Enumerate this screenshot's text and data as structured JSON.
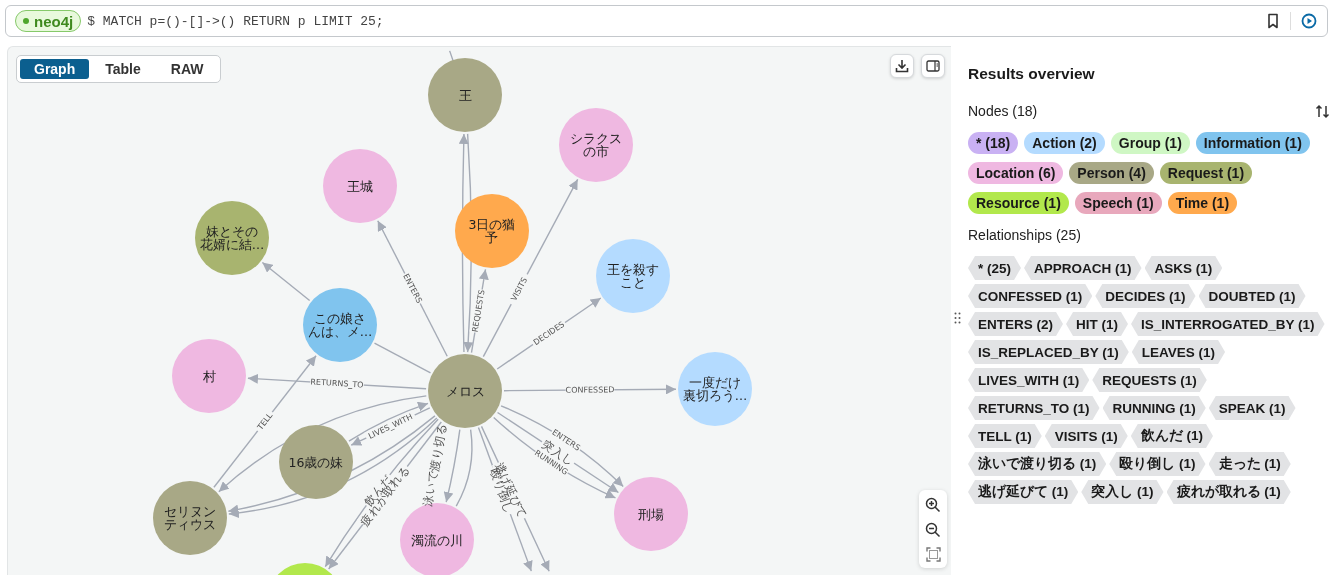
{
  "query_bar": {
    "database": "neo4j",
    "query": "$ MATCH p=()-[]->() RETURN p LIMIT 25;"
  },
  "view_tabs": [
    {
      "label": "Graph",
      "selected": true
    },
    {
      "label": "Table",
      "selected": false
    },
    {
      "label": "RAW",
      "selected": false
    }
  ],
  "graph": {
    "nodes": [
      {
        "lines": [
          "王"
        ],
        "color": "#a8a886"
      },
      {
        "lines": [
          "シラクス",
          "の市"
        ],
        "color": "#efb8e1"
      },
      {
        "lines": [
          "王城"
        ],
        "color": "#efb8e1"
      },
      {
        "lines": [
          "3日の猶",
          "予"
        ],
        "color": "#ffa94d"
      },
      {
        "lines": [
          "妹とその",
          "花婿に結…"
        ],
        "color": "#a8b46f"
      },
      {
        "lines": [
          "王を殺す",
          "こと"
        ],
        "color": "#b4dbff"
      },
      {
        "lines": [
          "この娘さ",
          "んは、メ…"
        ],
        "color": "#80c4ee"
      },
      {
        "lines": [
          "村"
        ],
        "color": "#efb8e1"
      },
      {
        "lines": [
          "メロス"
        ],
        "color": "#a8a886"
      },
      {
        "lines": [
          "一度だけ",
          "裏切ろう…"
        ],
        "color": "#b4dbff"
      },
      {
        "lines": [
          "16歳の妹"
        ],
        "color": "#a8a886"
      },
      {
        "lines": [
          "セリヌン",
          "ティウス"
        ],
        "color": "#a8a886"
      },
      {
        "lines": [
          "刑場"
        ],
        "color": "#efb8e1"
      },
      {
        "lines": [
          "濁流の川"
        ],
        "color": "#efb8e1"
      },
      {
        "color": "#b2e84c"
      }
    ],
    "relationships": [
      {
        "label": "ENTERS"
      },
      {
        "label": "REQUESTS"
      },
      {
        "label": "VISITS"
      },
      {
        "label": "DECIDES"
      },
      {
        "label": "CONFESSED"
      },
      {
        "label": "RETURNS_TO"
      },
      {
        "label": "TELL"
      },
      {
        "label": "LIVES_WITH"
      },
      {
        "label": "ENTERS"
      },
      {
        "label": "突入し"
      },
      {
        "label": "RUNNING"
      },
      {
        "label": "泳いで渡り切る"
      },
      {
        "label": "殴り倒し"
      },
      {
        "label": "逃げ延びて"
      },
      {
        "label": "疲れが取れる"
      },
      {
        "label": "飲んだ"
      }
    ]
  },
  "overview": {
    "title": "Results overview",
    "nodes_heading": "Nodes (18)",
    "node_labels": [
      {
        "text": "* (18)",
        "color": "#c9b1f3"
      },
      {
        "text": "Action (2)",
        "color": "#b4dbff"
      },
      {
        "text": "Group (1)",
        "color": "#cff7c4"
      },
      {
        "text": "Information (1)",
        "color": "#80c4ee"
      },
      {
        "text": "Location (6)",
        "color": "#efb8e1"
      },
      {
        "text": "Person (4)",
        "color": "#a8a886"
      },
      {
        "text": "Request (1)",
        "color": "#a8b46f"
      },
      {
        "text": "Resource (1)",
        "color": "#b2e84c"
      },
      {
        "text": "Speech (1)",
        "color": "#e8a8bc"
      },
      {
        "text": "Time (1)",
        "color": "#ffa94d"
      }
    ],
    "relationships_heading": "Relationships (25)",
    "relationship_types": [
      "* (25)",
      "APPROACH (1)",
      "ASKS (1)",
      "CONFESSED (1)",
      "DECIDES (1)",
      "DOUBTED (1)",
      "ENTERS (2)",
      "HIT (1)",
      "IS_INTERROGATED_BY (1)",
      "IS_REPLACED_BY (1)",
      "LEAVES (1)",
      "LIVES_WITH (1)",
      "REQUESTS (1)",
      "RETURNS_TO (1)",
      "RUNNING (1)",
      "SPEAK (1)",
      "TELL (1)",
      "VISITS (1)",
      "飲んだ (1)",
      "泳いで渡り切る (1)",
      "殴り倒し (1)",
      "走った (1)",
      "逃げ延びて (1)",
      "突入し (1)",
      "疲れが取れる (1)"
    ]
  }
}
